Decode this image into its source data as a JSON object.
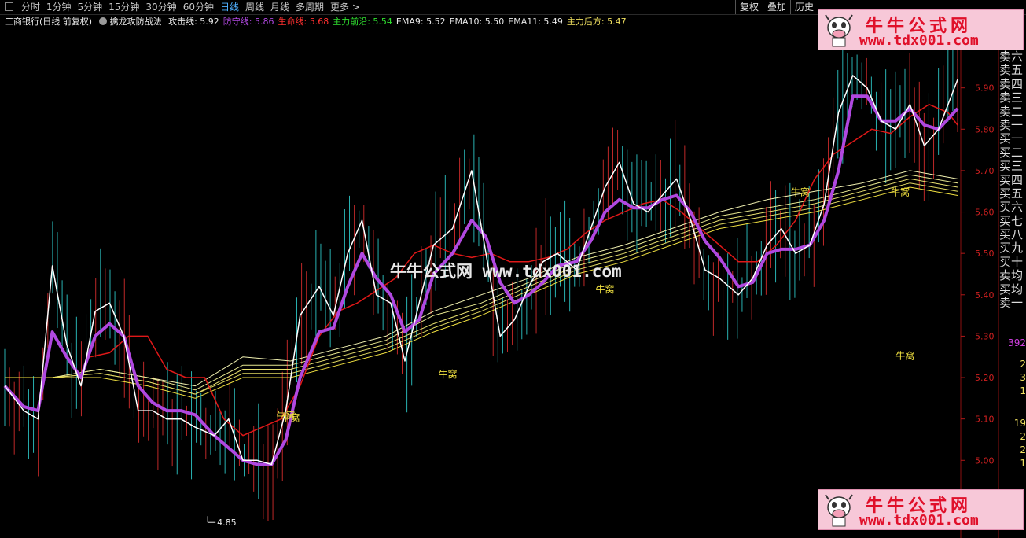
{
  "toolbar": {
    "tabs": [
      "分时",
      "1分钟",
      "5分钟",
      "15分钟",
      "30分钟",
      "60分钟",
      "日线",
      "周线",
      "月线",
      "多周期",
      "更多 >"
    ],
    "active_tab": "日线",
    "right_buttons": [
      "复权",
      "叠加",
      "历史"
    ]
  },
  "info": {
    "stock": "工商银行(日线 前复权)",
    "indicator": "擒龙攻防战法",
    "items": [
      {
        "text": "攻击线: 5.92",
        "color": "#e8e8e8"
      },
      {
        "text": "防守线: 5.86",
        "color": "#b048e0"
      },
      {
        "text": "生命线: 5.68",
        "color": "#ff3030"
      },
      {
        "text": "主力前沿: 5.54",
        "color": "#30e030"
      },
      {
        "text": "EMA9: 5.52",
        "color": "#e8e8e8"
      },
      {
        "text": "EMA10: 5.50",
        "color": "#e8e8e8"
      },
      {
        "text": "EMA11: 5.49",
        "color": "#e8e8e8"
      },
      {
        "text": "主力后方: 5.47",
        "color": "#f0e060"
      }
    ]
  },
  "watermark": {
    "title": "牛牛公式网",
    "url": "www.tdx001.com",
    "center_text": "牛牛公式网 www.tdx001.com"
  },
  "sidebar": {
    "labels": [
      "卖六",
      "卖五",
      "卖四",
      "卖三",
      "卖二",
      "卖一",
      "买一",
      "买二",
      "买三",
      "买四",
      "买五",
      "买六",
      "买七",
      "买八",
      "买九",
      "买十",
      "卖均",
      "买均",
      "卖一"
    ],
    "nums": [
      {
        "text": "392",
        "color": "#d040e0",
        "y": 429
      },
      {
        "text": "2",
        "color": "#f0e060",
        "y": 456
      },
      {
        "text": "3",
        "color": "#f0e060",
        "y": 473
      },
      {
        "text": "1",
        "color": "#f0e060",
        "y": 490
      },
      {
        "text": "19",
        "color": "#f0e060",
        "y": 531
      },
      {
        "text": "2",
        "color": "#f0e060",
        "y": 548
      },
      {
        "text": "2",
        "color": "#f0e060",
        "y": 565
      },
      {
        "text": "1",
        "color": "#f0e060",
        "y": 582
      }
    ]
  },
  "chart_data": {
    "type": "line",
    "ylim": [
      4.82,
      6.04
    ],
    "yticks": [
      "6.00",
      "5.90",
      "5.80",
      "5.70",
      "5.60",
      "5.50",
      "5.40",
      "5.30",
      "5.20",
      "5.10",
      "5.00"
    ],
    "low_label": "4.85",
    "annotation": "牛窝",
    "annotations": [
      {
        "text": "牛窝",
        "x": 0.285,
        "y": 5.1
      },
      {
        "text": "牛窝",
        "x": 0.29,
        "y": 5.095
      },
      {
        "text": "牛窝",
        "x": 0.455,
        "y": 5.2
      },
      {
        "text": "牛窝",
        "x": 0.62,
        "y": 5.405
      },
      {
        "text": "牛窝",
        "x": 0.825,
        "y": 5.64
      },
      {
        "text": "牛窝",
        "x": 0.93,
        "y": 5.64
      },
      {
        "text": "牛窝",
        "x": 0.935,
        "y": 5.245
      }
    ],
    "series": [
      {
        "name": "攻击线",
        "color": "#ffffff",
        "width": 1.5,
        "x": [
          0,
          0.02,
          0.035,
          0.05,
          0.065,
          0.08,
          0.095,
          0.11,
          0.125,
          0.14,
          0.155,
          0.17,
          0.185,
          0.2,
          0.22,
          0.235,
          0.25,
          0.265,
          0.28,
          0.295,
          0.31,
          0.33,
          0.345,
          0.36,
          0.375,
          0.39,
          0.405,
          0.42,
          0.435,
          0.45,
          0.47,
          0.49,
          0.505,
          0.52,
          0.535,
          0.55,
          0.565,
          0.58,
          0.6,
          0.615,
          0.63,
          0.645,
          0.66,
          0.675,
          0.69,
          0.705,
          0.72,
          0.735,
          0.75,
          0.77,
          0.785,
          0.8,
          0.815,
          0.83,
          0.845,
          0.86,
          0.875,
          0.89,
          0.905,
          0.92,
          0.935,
          0.95,
          0.965,
          0.98,
          1.0
        ],
        "y": [
          5.18,
          5.12,
          5.1,
          5.47,
          5.28,
          5.18,
          5.36,
          5.38,
          5.3,
          5.12,
          5.12,
          5.1,
          5.1,
          5.08,
          5.06,
          5.1,
          5.0,
          5.0,
          4.99,
          5.12,
          5.35,
          5.42,
          5.35,
          5.5,
          5.58,
          5.4,
          5.38,
          5.24,
          5.38,
          5.52,
          5.56,
          5.7,
          5.5,
          5.3,
          5.34,
          5.42,
          5.48,
          5.5,
          5.46,
          5.56,
          5.66,
          5.72,
          5.62,
          5.6,
          5.64,
          5.68,
          5.58,
          5.46,
          5.44,
          5.4,
          5.44,
          5.52,
          5.56,
          5.5,
          5.52,
          5.62,
          5.84,
          5.93,
          5.9,
          5.82,
          5.8,
          5.86,
          5.76,
          5.8,
          5.92
        ]
      },
      {
        "name": "防守线",
        "color": "#b048e0",
        "width": 4,
        "x": [
          0,
          0.02,
          0.035,
          0.05,
          0.065,
          0.08,
          0.095,
          0.11,
          0.125,
          0.14,
          0.155,
          0.17,
          0.185,
          0.2,
          0.22,
          0.235,
          0.25,
          0.265,
          0.28,
          0.295,
          0.31,
          0.33,
          0.345,
          0.36,
          0.375,
          0.39,
          0.405,
          0.42,
          0.435,
          0.45,
          0.47,
          0.49,
          0.505,
          0.52,
          0.535,
          0.55,
          0.565,
          0.58,
          0.6,
          0.615,
          0.63,
          0.645,
          0.66,
          0.675,
          0.69,
          0.705,
          0.72,
          0.735,
          0.75,
          0.77,
          0.785,
          0.8,
          0.815,
          0.83,
          0.845,
          0.86,
          0.875,
          0.89,
          0.905,
          0.92,
          0.935,
          0.95,
          0.965,
          0.98,
          1.0
        ],
        "y": [
          5.18,
          5.13,
          5.12,
          5.31,
          5.25,
          5.2,
          5.3,
          5.33,
          5.3,
          5.18,
          5.14,
          5.12,
          5.12,
          5.11,
          5.06,
          5.03,
          5.0,
          4.99,
          4.99,
          5.05,
          5.2,
          5.31,
          5.32,
          5.42,
          5.5,
          5.44,
          5.4,
          5.31,
          5.34,
          5.45,
          5.5,
          5.58,
          5.54,
          5.43,
          5.38,
          5.4,
          5.43,
          5.47,
          5.48,
          5.53,
          5.6,
          5.63,
          5.61,
          5.61,
          5.63,
          5.64,
          5.6,
          5.53,
          5.49,
          5.42,
          5.43,
          5.5,
          5.51,
          5.51,
          5.52,
          5.58,
          5.7,
          5.88,
          5.88,
          5.82,
          5.82,
          5.85,
          5.81,
          5.8,
          5.85
        ]
      },
      {
        "name": "生命线",
        "color": "#e01818",
        "width": 1.5,
        "x": [
          0.09,
          0.11,
          0.13,
          0.15,
          0.17,
          0.19,
          0.21,
          0.23,
          0.25,
          0.27,
          0.29,
          0.31,
          0.33,
          0.35,
          0.37,
          0.39,
          0.41,
          0.43,
          0.45,
          0.47,
          0.49,
          0.51,
          0.53,
          0.55,
          0.57,
          0.59,
          0.61,
          0.63,
          0.65,
          0.67,
          0.69,
          0.71,
          0.73,
          0.75,
          0.77,
          0.79,
          0.81,
          0.83,
          0.85,
          0.87,
          0.89,
          0.91,
          0.93,
          0.95,
          0.97,
          0.99,
          1.0
        ],
        "y": [
          5.25,
          5.26,
          5.3,
          5.3,
          5.22,
          5.2,
          5.2,
          5.1,
          5.06,
          5.08,
          5.1,
          5.18,
          5.3,
          5.36,
          5.38,
          5.41,
          5.44,
          5.5,
          5.52,
          5.5,
          5.49,
          5.5,
          5.48,
          5.48,
          5.49,
          5.51,
          5.55,
          5.58,
          5.6,
          5.62,
          5.63,
          5.6,
          5.56,
          5.52,
          5.48,
          5.48,
          5.52,
          5.58,
          5.68,
          5.74,
          5.77,
          5.8,
          5.79,
          5.83,
          5.86,
          5.84,
          5.81
        ]
      },
      {
        "name": "主力前沿",
        "color": "#f0f0b0",
        "width": 1,
        "x": [
          0,
          0.05,
          0.1,
          0.15,
          0.2,
          0.25,
          0.3,
          0.35,
          0.4,
          0.45,
          0.5,
          0.55,
          0.6,
          0.65,
          0.7,
          0.75,
          0.8,
          0.85,
          0.9,
          0.95,
          1.0
        ],
        "y": [
          5.2,
          5.2,
          5.22,
          5.2,
          5.18,
          5.25,
          5.24,
          5.27,
          5.3,
          5.36,
          5.4,
          5.44,
          5.49,
          5.52,
          5.56,
          5.6,
          5.63,
          5.65,
          5.67,
          5.7,
          5.68
        ]
      },
      {
        "name": "EMA9",
        "color": "#e8e890",
        "width": 1,
        "x": [
          0,
          0.05,
          0.1,
          0.15,
          0.2,
          0.25,
          0.3,
          0.35,
          0.4,
          0.45,
          0.5,
          0.55,
          0.6,
          0.65,
          0.7,
          0.75,
          0.8,
          0.85,
          0.9,
          0.95,
          1.0
        ],
        "y": [
          5.2,
          5.2,
          5.22,
          5.2,
          5.17,
          5.23,
          5.23,
          5.26,
          5.29,
          5.35,
          5.38,
          5.43,
          5.48,
          5.51,
          5.55,
          5.59,
          5.61,
          5.63,
          5.66,
          5.69,
          5.67
        ]
      },
      {
        "name": "EMA10",
        "color": "#e8e070",
        "width": 1,
        "x": [
          0,
          0.05,
          0.1,
          0.15,
          0.2,
          0.25,
          0.3,
          0.35,
          0.4,
          0.45,
          0.5,
          0.55,
          0.6,
          0.65,
          0.7,
          0.75,
          0.8,
          0.85,
          0.9,
          0.95,
          1.0
        ],
        "y": [
          5.2,
          5.2,
          5.21,
          5.19,
          5.16,
          5.22,
          5.22,
          5.25,
          5.28,
          5.33,
          5.37,
          5.42,
          5.47,
          5.5,
          5.54,
          5.58,
          5.6,
          5.62,
          5.65,
          5.68,
          5.66
        ]
      },
      {
        "name": "EMA11",
        "color": "#e0d860",
        "width": 1,
        "x": [
          0,
          0.05,
          0.1,
          0.15,
          0.2,
          0.25,
          0.3,
          0.35,
          0.4,
          0.45,
          0.5,
          0.55,
          0.6,
          0.65,
          0.7,
          0.75,
          0.8,
          0.85,
          0.9,
          0.95,
          1.0
        ],
        "y": [
          5.2,
          5.2,
          5.21,
          5.19,
          5.16,
          5.21,
          5.21,
          5.24,
          5.27,
          5.32,
          5.36,
          5.41,
          5.46,
          5.49,
          5.53,
          5.57,
          5.59,
          5.61,
          5.64,
          5.67,
          5.65
        ]
      },
      {
        "name": "主力后方",
        "color": "#f0e040",
        "width": 1,
        "x": [
          0,
          0.05,
          0.1,
          0.15,
          0.2,
          0.25,
          0.3,
          0.35,
          0.4,
          0.45,
          0.5,
          0.55,
          0.6,
          0.65,
          0.7,
          0.75,
          0.8,
          0.85,
          0.9,
          0.95,
          1.0
        ],
        "y": [
          5.2,
          5.2,
          5.2,
          5.18,
          5.15,
          5.2,
          5.2,
          5.23,
          5.26,
          5.31,
          5.35,
          5.4,
          5.45,
          5.48,
          5.52,
          5.56,
          5.58,
          5.6,
          5.63,
          5.66,
          5.64
        ]
      }
    ]
  }
}
